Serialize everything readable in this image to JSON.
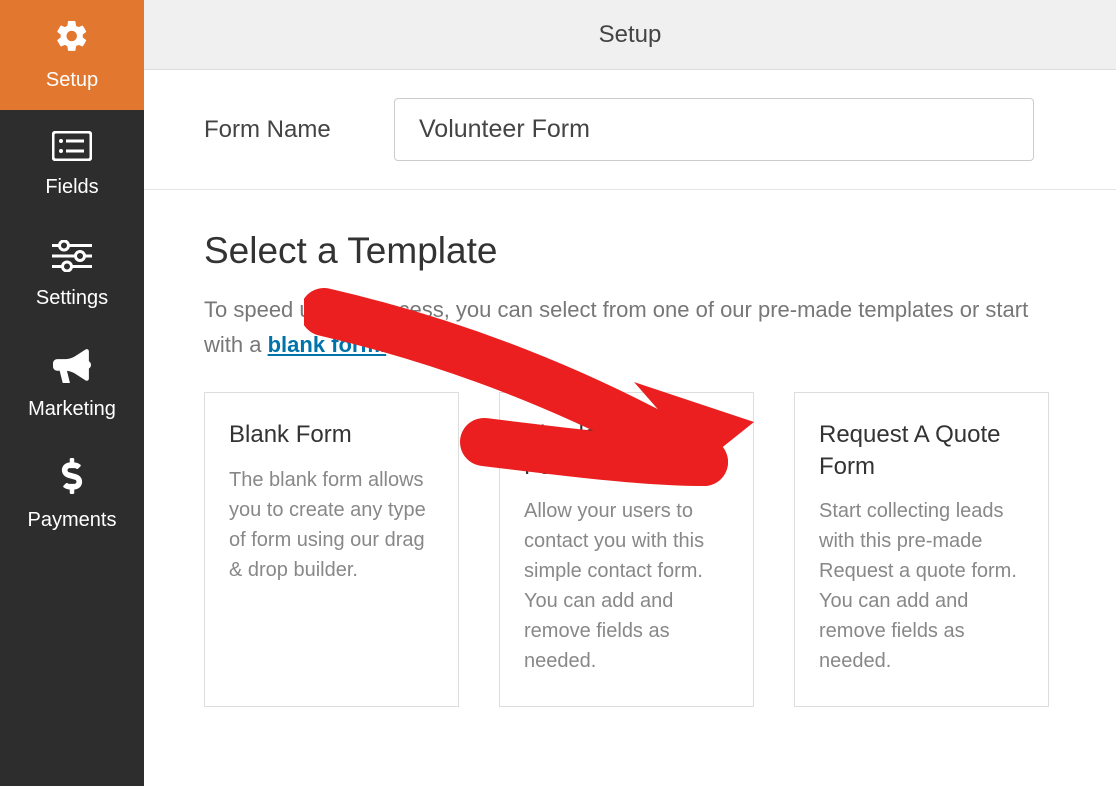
{
  "sidebar": {
    "items": [
      {
        "label": "Setup"
      },
      {
        "label": "Fields"
      },
      {
        "label": "Settings"
      },
      {
        "label": "Marketing"
      },
      {
        "label": "Payments"
      }
    ]
  },
  "header": {
    "title": "Setup"
  },
  "form_name": {
    "label": "Form Name",
    "value": "Volunteer Form"
  },
  "template_section": {
    "heading": "Select a Template",
    "description_pre": "To speed up the process, you can select from one of our pre-made templates or start with a ",
    "link_text": "blank form.",
    "templates": [
      {
        "title": "Blank Form",
        "desc": "The blank form allows you to create any type of form using our drag & drop builder."
      },
      {
        "title": "Simple Contact Form",
        "desc": "Allow your users to contact you with this simple contact form. You can add and remove fields as needed."
      },
      {
        "title": "Request A Quote Form",
        "desc": "Start collecting leads with this pre-made Request a quote form. You can add and remove fields as needed."
      }
    ]
  }
}
